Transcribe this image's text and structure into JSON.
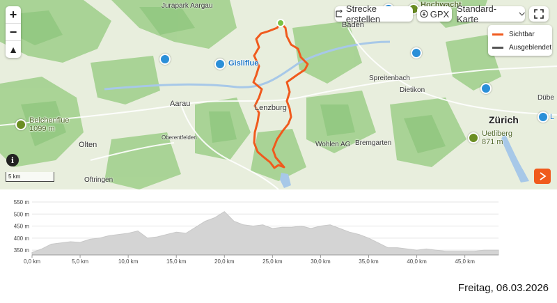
{
  "toolbar": {
    "create_route_label": "Strecke erstellen",
    "gpx_label": "GPX",
    "map_type_label": "Standard-Karte"
  },
  "zoom": {
    "in": "+",
    "out": "−",
    "north": "▲"
  },
  "legend": {
    "visible_label": "Sichtbar",
    "visible_color": "#f05a1d",
    "hidden_label": "Ausgeblendet",
    "hidden_color": "#555555"
  },
  "places": {
    "jurapark": "Jurapark Aargau",
    "hochwacht": "Hochwacht",
    "baden": "Baden",
    "gisliflue": "Gisliflue",
    "spreitenbach": "Spreitenbach",
    "dietikon": "Dietikon",
    "aarau": "Aarau",
    "lenzburg": "Lenzburg",
    "zurich": "Zürich",
    "dubendorf": "Dübe",
    "belchenflue": "Belchenflue",
    "belchenflue_elev": "1099 m",
    "oberentfelden": "Oberentfelden",
    "olten": "Olten",
    "wohlen": "Wohlen AG",
    "bremgarten": "Bremgarten",
    "uetliberg": "Uetliberg",
    "uetliberg_elev": "871 m",
    "oftringen": "Oftringen",
    "l_partial": "L"
  },
  "scale_label": "5 km",
  "info_label": "i",
  "colors": {
    "route": "#f05a1d",
    "poi_blue": "#2a8fd8",
    "poi_green": "#6b8e23",
    "start": "#7ac143"
  },
  "chart_data": {
    "type": "area",
    "xlabel": "",
    "ylabel": "",
    "x_ticks": [
      "0,0 km",
      "5,0 km",
      "10,0 km",
      "15,0 km",
      "20,0 km",
      "25,0 km",
      "30,0 km",
      "35,0 km",
      "40,0 km",
      "45,0 km"
    ],
    "y_ticks": [
      "350 m",
      "400 m",
      "450 m",
      "500 m",
      "550 m"
    ],
    "xlim": [
      0,
      48.5
    ],
    "ylim": [
      330,
      550
    ],
    "x": [
      0,
      1,
      2,
      3,
      4,
      5,
      6,
      7,
      8,
      9,
      10,
      11,
      12,
      13,
      14,
      15,
      16,
      17,
      18,
      19,
      20,
      21,
      22,
      23,
      24,
      25,
      26,
      27,
      28,
      29,
      30,
      31,
      32,
      33,
      34,
      35,
      36,
      37,
      38,
      39,
      40,
      41,
      42,
      43,
      44,
      45,
      46,
      47,
      48,
      48.5
    ],
    "y": [
      340,
      355,
      375,
      380,
      385,
      382,
      395,
      400,
      410,
      415,
      420,
      430,
      400,
      405,
      415,
      425,
      420,
      445,
      470,
      485,
      510,
      470,
      455,
      450,
      455,
      440,
      445,
      445,
      450,
      440,
      450,
      455,
      440,
      425,
      415,
      400,
      380,
      360,
      360,
      355,
      350,
      355,
      350,
      345,
      345,
      345,
      345,
      350,
      350,
      350
    ],
    "fill": "#d4d4d4"
  },
  "date": "Freitag, 06.03.2026"
}
